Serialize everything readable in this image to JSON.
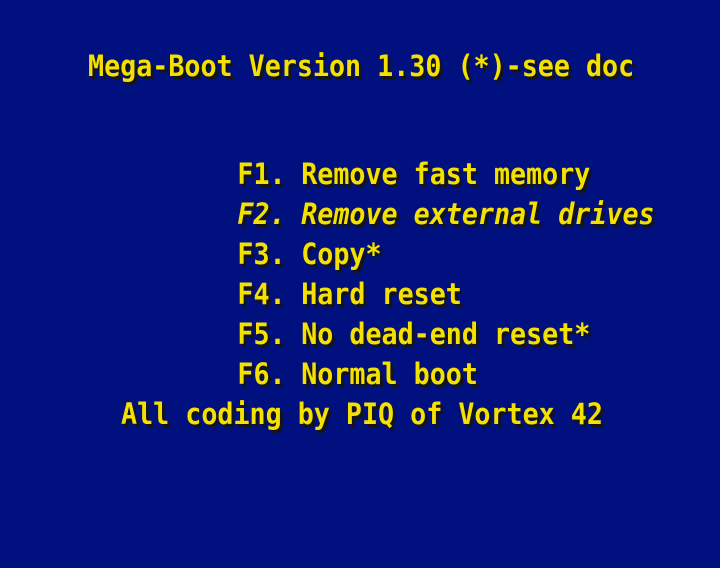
{
  "title": "Mega-Boot Version 1.30 (*)-see doc",
  "menu": {
    "items": [
      {
        "key": "F1.",
        "label": "Remove fast memory"
      },
      {
        "key": "F2.",
        "label": "Remove external drives",
        "highlighted": true
      },
      {
        "key": "F3.",
        "label": "Copy*"
      },
      {
        "key": "F4.",
        "label": "Hard reset"
      },
      {
        "key": "F5.",
        "label": "No dead-end reset*"
      },
      {
        "key": "F6.",
        "label": "Normal boot"
      }
    ]
  },
  "credit": "All coding by PIQ of Vortex 42",
  "colors": {
    "background": "#00117f",
    "text": "#f4e100",
    "shadow": "#141414"
  }
}
